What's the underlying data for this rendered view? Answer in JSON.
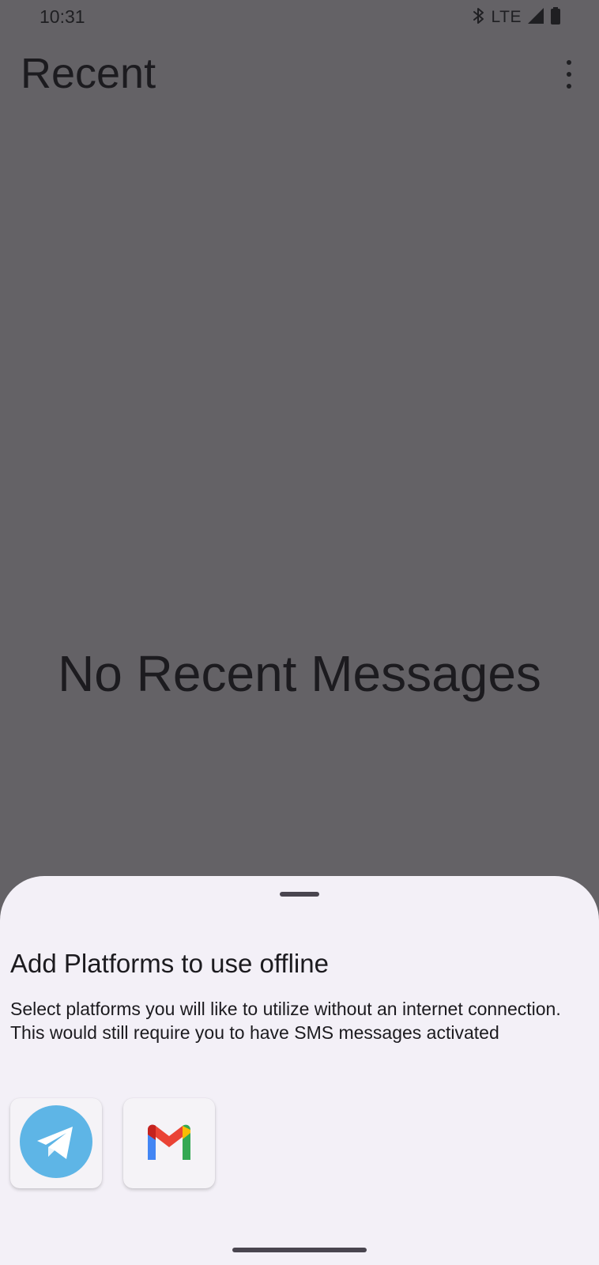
{
  "status_bar": {
    "time": "10:31",
    "network": "LTE",
    "icons": [
      "bluetooth-icon",
      "signal-icon",
      "battery-icon"
    ]
  },
  "app_bar": {
    "title": "Recent",
    "menu_icon": "more-vert-icon"
  },
  "main": {
    "empty_message": "No Recent Messages"
  },
  "sheet": {
    "title": "Add Platforms to use offline",
    "description": "Select platforms you will like to utilize without an internet connection. This would still require you to have SMS messages activated",
    "platforms": [
      {
        "name": "Telegram",
        "icon": "telegram-icon",
        "color": "#5eb5e6"
      },
      {
        "name": "Gmail",
        "icon": "gmail-icon",
        "colors": [
          "#ea4335",
          "#4285f4",
          "#34a853",
          "#fbbc04",
          "#c5221f"
        ]
      }
    ]
  },
  "colors": {
    "scrim_background": "#646266",
    "sheet_background": "#f3f0f7",
    "text_primary": "#1c1b1f"
  }
}
